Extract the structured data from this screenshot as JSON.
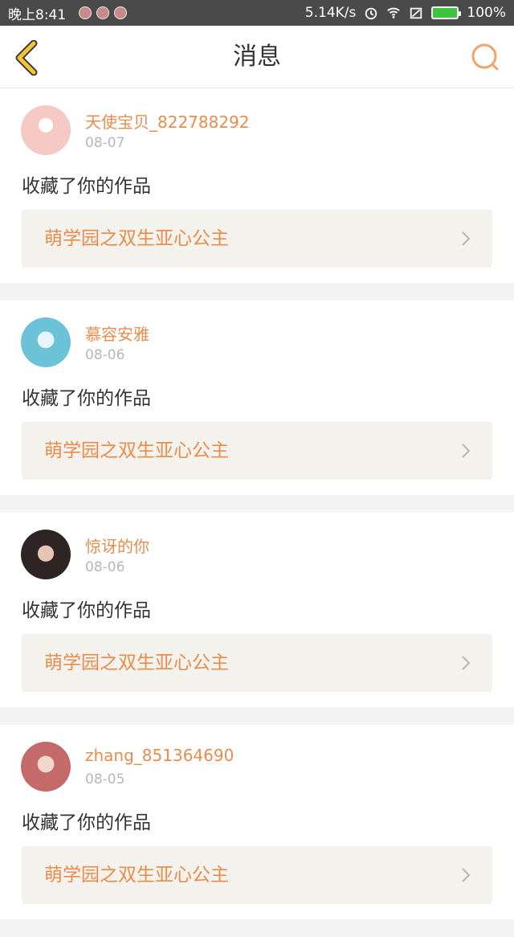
{
  "status_bar": {
    "time": "晚上8:41",
    "speed": "5.14K/s",
    "battery": "100%",
    "icons": [
      "app-notification-icon",
      "app-notification-icon",
      "app-notification-icon",
      "alarm-icon",
      "wifi-icon",
      "signal-icon",
      "battery-icon"
    ]
  },
  "header": {
    "title": "消息",
    "back_icon": "chevron-left-icon",
    "search_icon": "search-icon"
  },
  "colors": {
    "accent": "#e88d4d",
    "back_arrow": "#f2c531",
    "card_bg": "#ffffff",
    "link_bg": "#f4f2ec"
  },
  "messages": [
    {
      "username": "天使宝贝_822788292",
      "date": "08-07",
      "action": "收藏了你的作品",
      "work": "萌学园之双生亚心公主",
      "avatar_color": "#f5c9c4"
    },
    {
      "username": "慕容安雅",
      "date": "08-06",
      "action": "收藏了你的作品",
      "work": "萌学园之双生亚心公主",
      "avatar_color": "#6cc3d8"
    },
    {
      "username": "惊讶的你",
      "date": "08-06",
      "action": "收藏了你的作品",
      "work": "萌学园之双生亚心公主",
      "avatar_color": "#3b2e2e"
    },
    {
      "username": "zhang_851364690",
      "date": "08-05",
      "action": "收藏了你的作品",
      "work": "萌学园之双生亚心公主",
      "avatar_color": "#c46a6a"
    }
  ]
}
